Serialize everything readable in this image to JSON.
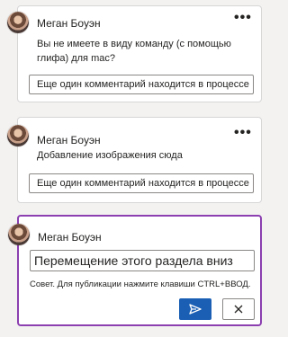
{
  "comments": [
    {
      "author": "Меган Боуэн",
      "more_label": "•••",
      "text": "Вы не имеете в виду команду (с помощью глифа) для mac?",
      "pending_label": "Еще один комментарий находится в процессе"
    },
    {
      "author": "Меган Боуэн",
      "more_label": "•••",
      "text": "Добавление изображения сюда",
      "pending_label": "Еще один комментарий находится в процессе"
    }
  ],
  "composer": {
    "author": "Меган Боуэн",
    "input_value": "Перемещение этого раздела вниз",
    "hint": "Совет. Для публикации нажмите клавиши CTRL+ВВОД.",
    "send_icon": "send-icon",
    "cancel_icon": "close-icon"
  },
  "colors": {
    "accent": "#8b3fb0",
    "primary_button": "#1a5fb4",
    "background": "#f3f2f1"
  }
}
